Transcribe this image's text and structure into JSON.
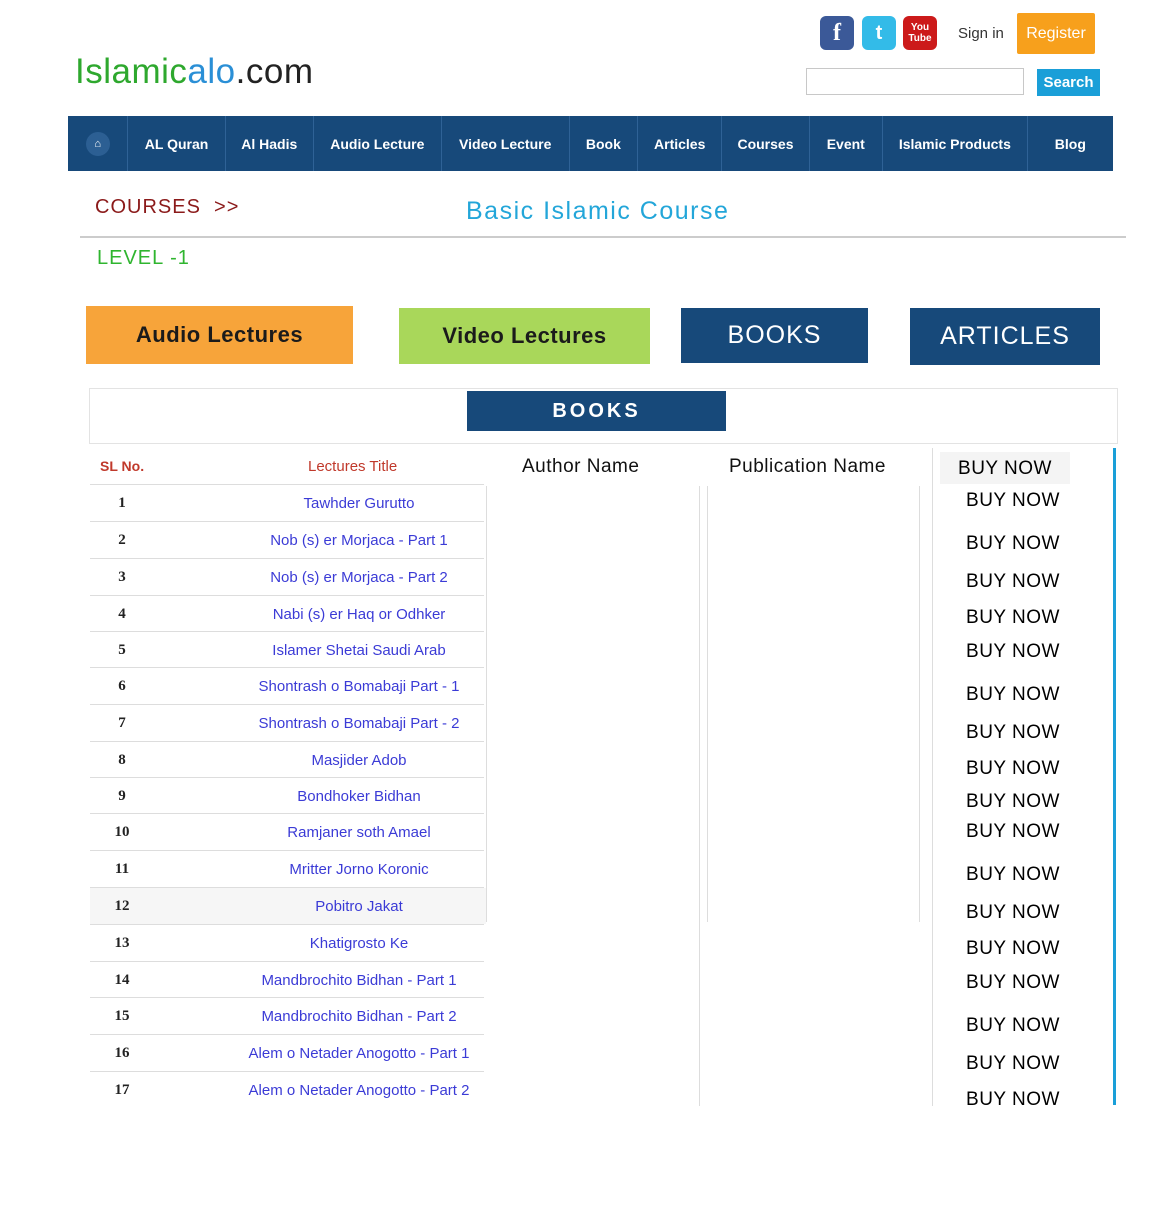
{
  "site": {
    "logo_part1": "Islamic",
    "logo_part2": "alo",
    "logo_part3": ".com"
  },
  "header": {
    "facebook_icon": "f",
    "twitter_icon": "t",
    "youtube_icon_line1": "You",
    "youtube_icon_line2": "Tube",
    "sign_in": "Sign in",
    "register": "Register",
    "search_placeholder": "",
    "search_button": "Search"
  },
  "nav": {
    "home_icon": "⌂",
    "items": [
      "AL Quran",
      "Al Hadis",
      "Audio Lecture",
      "Video Lecture",
      "Book",
      "Articles",
      "Courses",
      "Event",
      "Islamic Products",
      "Blog"
    ]
  },
  "page": {
    "breadcrumb": "COURSES  >>",
    "title": "Basic Islamic Course",
    "level": "LEVEL -1"
  },
  "tabs": {
    "audio": "Audio Lectures",
    "video": "Video Lectures",
    "books": "BOOKS",
    "articles": "ARTICLES"
  },
  "section": {
    "label": "BOOKS"
  },
  "table": {
    "headers": {
      "sl": "SL No.",
      "title": "Lectures Title",
      "author": "Author Name",
      "publication": "Publication Name",
      "buy": "BUY NOW"
    },
    "rows": [
      {
        "sl": "1",
        "title": "Tawhder Gurutto",
        "buy": "BUY NOW"
      },
      {
        "sl": "2",
        "title": "Nob (s) er Morjaca - Part 1",
        "buy": "BUY NOW"
      },
      {
        "sl": "3",
        "title": "Nob (s) er Morjaca - Part 2",
        "buy": "BUY NOW"
      },
      {
        "sl": "4",
        "title": "Nabi (s) er Haq or Odhker",
        "buy": "BUY NOW"
      },
      {
        "sl": "5",
        "title": "Islamer Shetai Saudi Arab",
        "buy": "BUY NOW"
      },
      {
        "sl": "6",
        "title": "Shontrash o Bomabaji Part - 1",
        "buy": "BUY NOW"
      },
      {
        "sl": "7",
        "title": "Shontrash o Bomabaji Part - 2",
        "buy": "BUY NOW"
      },
      {
        "sl": "8",
        "title": "Masjider Adob",
        "buy": "BUY NOW"
      },
      {
        "sl": "9",
        "title": "Bondhoker Bidhan",
        "buy": "BUY NOW"
      },
      {
        "sl": "10",
        "title": "Ramjaner soth Amael",
        "buy": "BUY NOW"
      },
      {
        "sl": "11",
        "title": "Mritter Jorno Koronic",
        "buy": "BUY NOW"
      },
      {
        "sl": "12",
        "title": "Pobitro Jakat",
        "buy": "BUY NOW"
      },
      {
        "sl": "13",
        "title": "Khatigrosto Ke",
        "buy": "BUY NOW"
      },
      {
        "sl": "14",
        "title": "Mandbrochito Bidhan - Part 1",
        "buy": "BUY NOW"
      },
      {
        "sl": "15",
        "title": "Mandbrochito Bidhan - Part 2",
        "buy": "BUY NOW"
      },
      {
        "sl": "16",
        "title": "Alem o Netader Anogotto - Part 1",
        "buy": "BUY NOW"
      },
      {
        "sl": "17",
        "title": "Alem o Netader Anogotto - Part 2",
        "buy": "BUY NOW"
      }
    ]
  }
}
